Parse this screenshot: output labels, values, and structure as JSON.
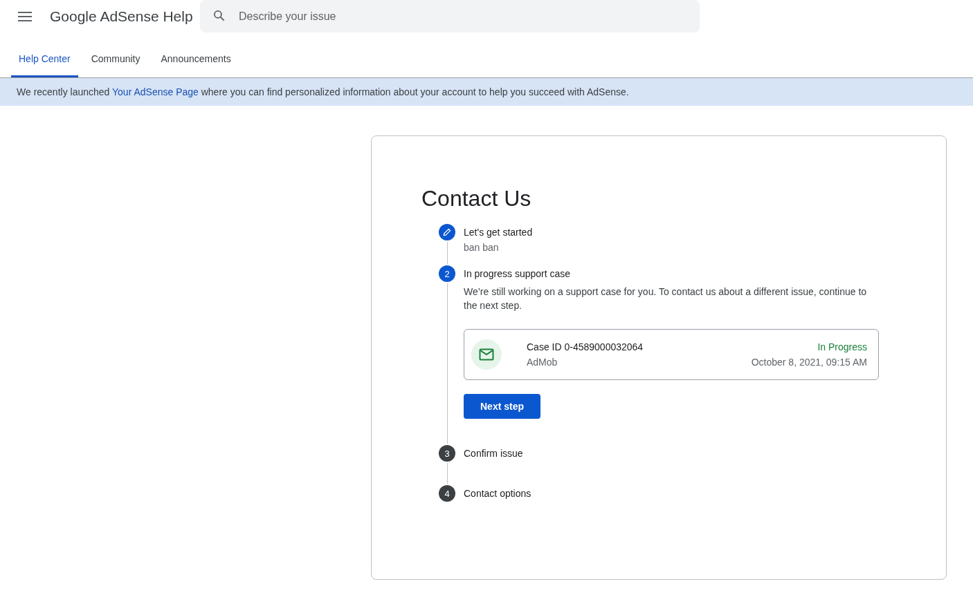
{
  "header": {
    "title": "Google AdSense Help",
    "search": {
      "placeholder": "Describe your issue"
    }
  },
  "tabs": [
    {
      "label": "Help Center",
      "selected": true
    },
    {
      "label": "Community",
      "selected": false
    },
    {
      "label": "Announcements",
      "selected": false
    }
  ],
  "banner": {
    "before": "We recently launched ",
    "link": "Your AdSense Page",
    "after": " where you can find personalized information about your account to help you succeed with AdSense."
  },
  "contact": {
    "title": "Contact Us",
    "steps": [
      {
        "kind": "done",
        "title": "Let's get started",
        "detail": "ban ban"
      },
      {
        "kind": "active",
        "number": "2",
        "title": "In progress support case",
        "description": "We’re still working on a support case for you. To contact us about a different issue, continue to the next step.",
        "case": {
          "case_id": "Case ID 0-4589000032064",
          "product": "AdMob",
          "status": "In Progress",
          "date": "October 8, 2021, 09:15 AM"
        },
        "button": "Next step"
      },
      {
        "kind": "pending",
        "number": "3",
        "title": "Confirm issue"
      },
      {
        "kind": "pending",
        "number": "4",
        "title": "Contact options"
      }
    ]
  }
}
